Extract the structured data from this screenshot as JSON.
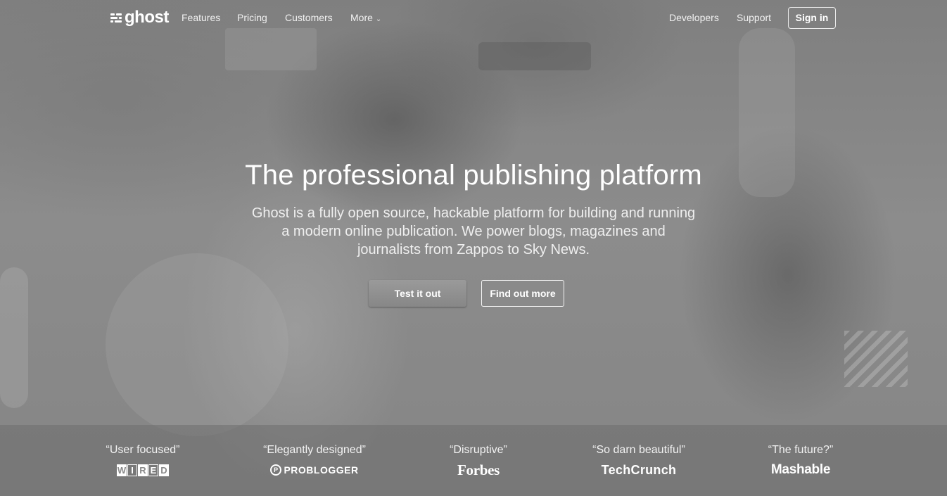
{
  "nav": {
    "logo_text": "ghost",
    "links": [
      {
        "label": "Features"
      },
      {
        "label": "Pricing"
      },
      {
        "label": "Customers"
      },
      {
        "label": "More"
      }
    ],
    "right_links": [
      {
        "label": "Developers"
      },
      {
        "label": "Support"
      }
    ],
    "signin_label": "Sign in"
  },
  "hero": {
    "title": "The professional publishing platform",
    "subtitle_lines": [
      "Ghost is a fully open source, hackable platform for building and running",
      "a modern online publication. We power blogs, magazines and",
      "journalists from Zappos to Sky News."
    ],
    "primary_button": "Test it out",
    "secondary_button": "Find out more"
  },
  "press": [
    {
      "quote": "“User focused”",
      "brand": "WIRED",
      "icon": "wired-logo"
    },
    {
      "quote": "“Elegantly designed”",
      "brand": "PROBLOGGER",
      "icon": "problogger-logo"
    },
    {
      "quote": "“Disruptive”",
      "brand": "Forbes",
      "icon": "forbes-logo"
    },
    {
      "quote": "“So darn beautiful”",
      "brand": "TechCrunch",
      "icon": "techcrunch-logo"
    },
    {
      "quote": "“The future?”",
      "brand": "Mashable",
      "icon": "mashable-logo"
    }
  ],
  "colors": {
    "background": "#8a8a8a",
    "text": "#ffffff",
    "press_strip": "#6e6e6e"
  }
}
